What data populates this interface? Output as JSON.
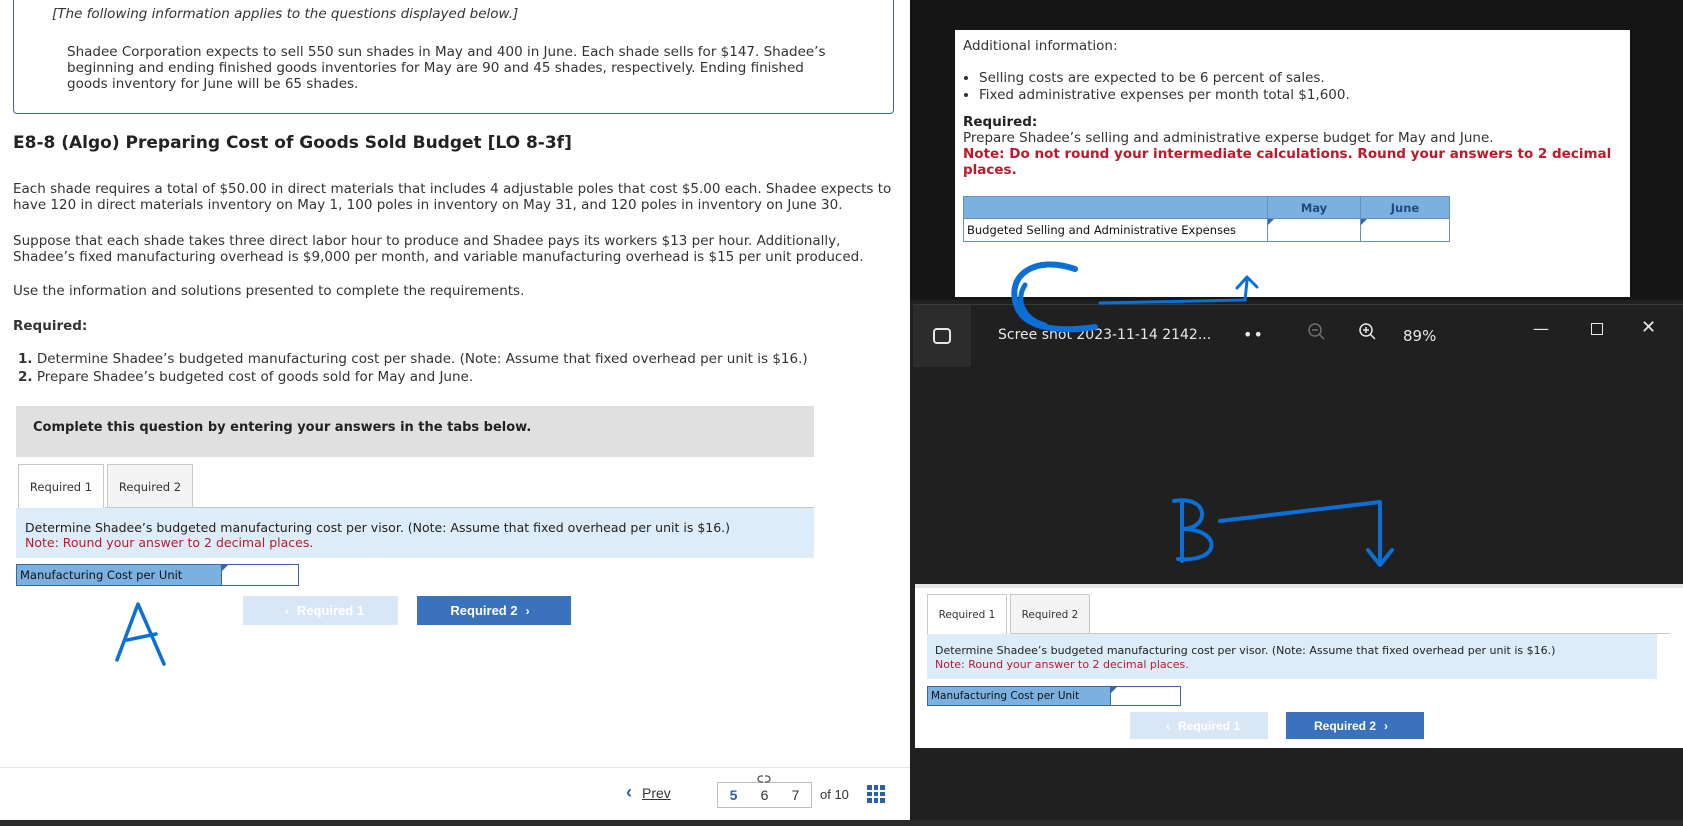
{
  "info_box": {
    "italic": "[The following information applies to the questions displayed below.]",
    "text": "Shadee Corporation expects to sell 550 sun shades in May and 400 in June. Each shade sells for $147. Shadee’s beginning and ending finished goods inventories for May are 90 and 45 shades, respectively. Ending finished goods inventory for June will be 65 shades."
  },
  "question": {
    "title": "E8-8 (Algo) Preparing Cost of Goods Sold Budget [LO 8-3f]",
    "para1": "Each shade requires a total of $50.00 in direct materials that includes 4 adjustable poles that cost $5.00 each. Shadee expects to have 120 in direct materials inventory on May 1, 100 poles in inventory on May 31, and 120 poles in inventory on June 30.",
    "para2": "Suppose that each shade takes three direct labor hour to produce and Shadee pays its workers $13 per hour. Additionally, Shadee’s fixed manufacturing overhead is $9,000 per month, and  variable manufacturing overhead is $15 per unit produced.",
    "para3": "Use the information and solutions presented to complete the requirements.",
    "required_label": "Required:",
    "req1_num": "1.",
    "req1": "Determine Shadee’s budgeted manufacturing cost per shade. (Note: Assume that fixed overhead per unit is $16.)",
    "req2_num": "2.",
    "req2": "Prepare Shadee’s budgeted cost of goods sold for May and June.",
    "complete_text": "Complete this question by entering your answers in the tabs below."
  },
  "tabs": [
    "Required 1",
    "Required 2"
  ],
  "instruction": {
    "text": "Determine Shadee’s budgeted manufacturing cost per visor. (Note: Assume that fixed overhead per unit is $16.)",
    "note": "Note: Round your answer to 2 decimal places."
  },
  "mfg_label": "Manufacturing Cost per Unit",
  "nav": {
    "prev_label": "Required 1",
    "next_label": "Required 2"
  },
  "pager": {
    "prev": "Prev",
    "pages": [
      "5",
      "6",
      "7"
    ],
    "current": "5",
    "of": "of 10"
  },
  "additional": {
    "heading": "Additional information:",
    "bullets": [
      "Selling costs are expected to be 6 percent of sales.",
      "Fixed administrative expenses per month total $1,600."
    ],
    "required_label": "Required:",
    "prepare": "Prepare Shadee’s selling and administrative experse budget for May and June.",
    "note": "Note: Do not round your intermediate calculations. Round your answers to 2 decimal places.",
    "table": {
      "columns": [
        "May",
        "June"
      ],
      "row_label": "Budgeted Selling and Administrative Expenses"
    }
  },
  "viewer": {
    "title": "Scree shot 2023-11-14 2142...",
    "dots": "••",
    "zoom": "89%",
    "minimize": "—",
    "close": "✕"
  },
  "annotations": {
    "a": "A",
    "b": "B",
    "c": "C",
    "color": "#0a6fd6"
  }
}
